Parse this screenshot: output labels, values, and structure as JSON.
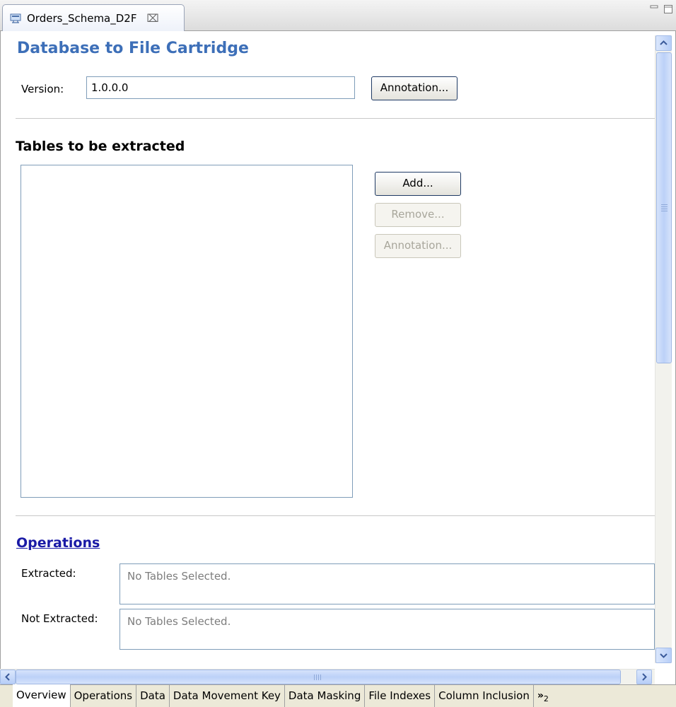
{
  "editor_tab": {
    "title": "Orders_Schema_D2F",
    "close_glyph": "⌧"
  },
  "form": {
    "title": "Database to File Cartridge",
    "version_label": "Version:",
    "version_value": "1.0.0.0",
    "annotation_button": "Annotation..."
  },
  "tables": {
    "heading": "Tables to be extracted",
    "add_button": "Add...",
    "remove_button": "Remove...",
    "annotation_button": "Annotation..."
  },
  "operations": {
    "heading": "Operations",
    "extracted_label": "Extracted:",
    "extracted_value": "No Tables Selected.",
    "not_extracted_label": "Not Extracted:",
    "not_extracted_value": "No Tables Selected."
  },
  "page_tabs": {
    "items": [
      "Overview",
      "Operations",
      "Data",
      "Data Movement Key",
      "Data Masking",
      "File Indexes",
      "Column Inclusion"
    ],
    "overflow_glyph": "»",
    "overflow_count": "2",
    "active": "Overview"
  },
  "icons": {
    "tab": "cartridge-editor-icon",
    "minimize": "minimize-icon",
    "maximize": "maximize-icon",
    "scroll_up": "chevron-up-icon",
    "scroll_down": "chevron-down-icon",
    "scroll_left": "chevron-left-icon",
    "scroll_right": "chevron-right-icon"
  },
  "colors": {
    "title": "#3d6fb8",
    "link": "#1a1aa6",
    "scroll_thumb": "#bcd1f8",
    "placeholder_text": "#7d7d7d"
  }
}
